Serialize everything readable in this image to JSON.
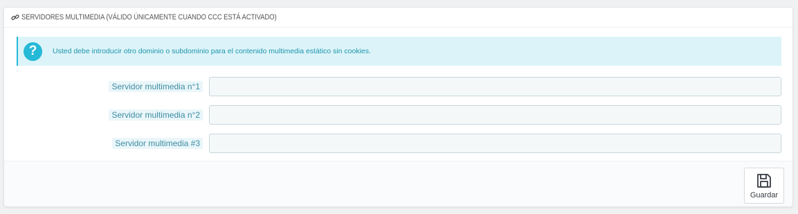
{
  "panel": {
    "title": "SERVIDORES MULTIMEDIA (VÁLIDO ÚNICAMENTE CUANDO CCC ESTÁ ACTIVADO)",
    "title_icon": "link-icon"
  },
  "alert": {
    "icon": "help-icon",
    "text": "Usted debe introducir otro dominio o subdominio para el contenido multimedia estático sin cookies."
  },
  "form": {
    "fields": [
      {
        "label": "Servidor multimedia n°1",
        "value": ""
      },
      {
        "label": "Servidor multimedia n°2",
        "value": ""
      },
      {
        "label": "Servidor multimedia #3",
        "value": ""
      }
    ]
  },
  "footer": {
    "save_label": "Guardar",
    "save_icon": "save-icon"
  },
  "colors": {
    "accent": "#25b9d7",
    "alert_bg": "#dcf4f9",
    "alert_text": "#1e94ab",
    "label_text": "#3d8da3"
  }
}
